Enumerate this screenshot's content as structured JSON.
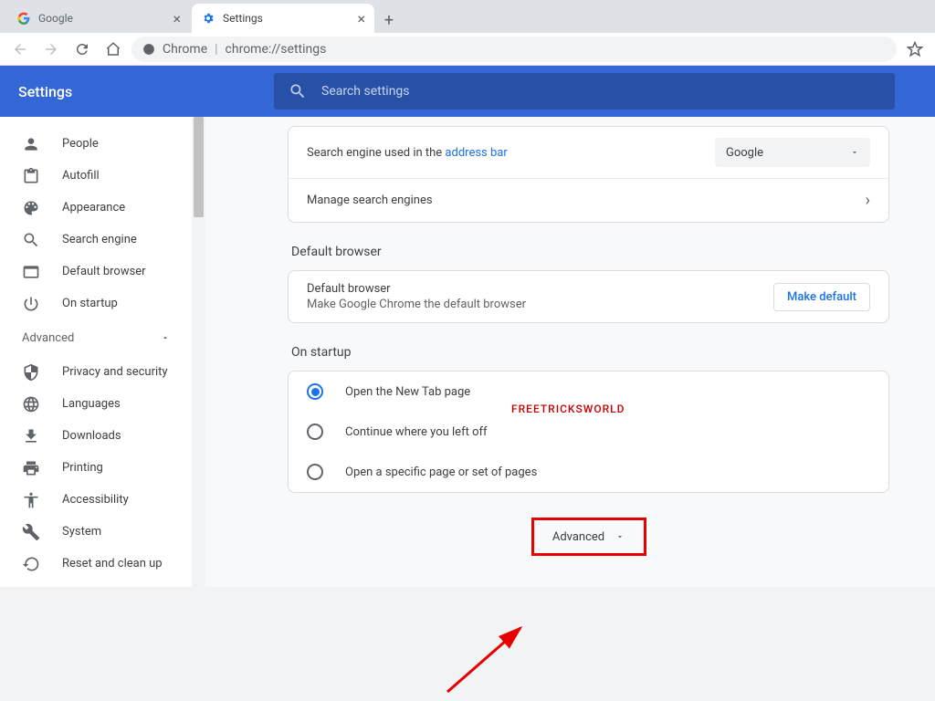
{
  "tabs": [
    {
      "label": "Google"
    },
    {
      "label": "Settings"
    }
  ],
  "omnibox": {
    "host": "Chrome",
    "path": "chrome://settings"
  },
  "header": {
    "title": "Settings"
  },
  "search": {
    "placeholder": "Search settings"
  },
  "sidebar": {
    "items": [
      {
        "label": "People"
      },
      {
        "label": "Autofill"
      },
      {
        "label": "Appearance"
      },
      {
        "label": "Search engine"
      },
      {
        "label": "Default browser"
      },
      {
        "label": "On startup"
      }
    ],
    "advanced_label": "Advanced",
    "advanced_items": [
      {
        "label": "Privacy and security"
      },
      {
        "label": "Languages"
      },
      {
        "label": "Downloads"
      },
      {
        "label": "Printing"
      },
      {
        "label": "Accessibility"
      },
      {
        "label": "System"
      },
      {
        "label": "Reset and clean up"
      }
    ]
  },
  "search_engine": {
    "prefix": "Search engine used in the ",
    "link": "address bar",
    "selected": "Google",
    "manage": "Manage search engines"
  },
  "default_browser": {
    "section_title": "Default browser",
    "row_title": "Default browser",
    "row_sub": "Make Google Chrome the default browser",
    "button": "Make default"
  },
  "on_startup": {
    "section_title": "On startup",
    "options": [
      "Open the New Tab page",
      "Continue where you left off",
      "Open a specific page or set of pages"
    ]
  },
  "advanced_button": "Advanced",
  "watermark": "FREETRICKSWORLD"
}
